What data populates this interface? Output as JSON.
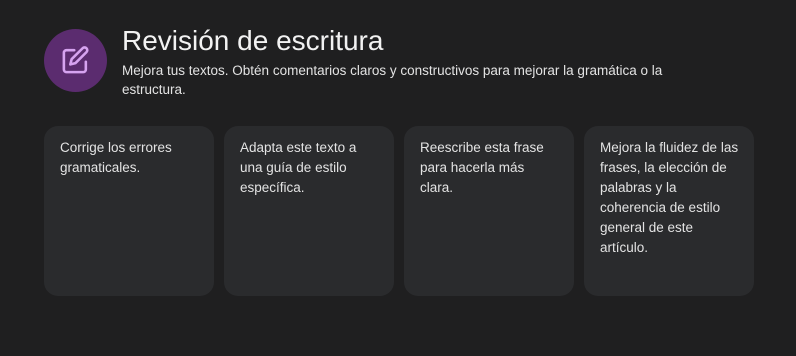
{
  "header": {
    "icon": "edit-note-icon",
    "accent_color": "#5b2c6f",
    "icon_color": "#d6a3f0",
    "title": "Revisión de escritura",
    "subtitle": "Mejora tus textos. Obtén comentarios claros y constructivos para mejorar la gramática o la estructura."
  },
  "cards": [
    {
      "text": "Corrige los errores gramaticales."
    },
    {
      "text": "Adapta este texto a una guía de estilo específica."
    },
    {
      "text": "Reescribe esta frase para hacerla más clara."
    },
    {
      "text": "Mejora la fluidez de las frases, la elección de palabras y la coherencia de estilo general de este artículo."
    }
  ]
}
